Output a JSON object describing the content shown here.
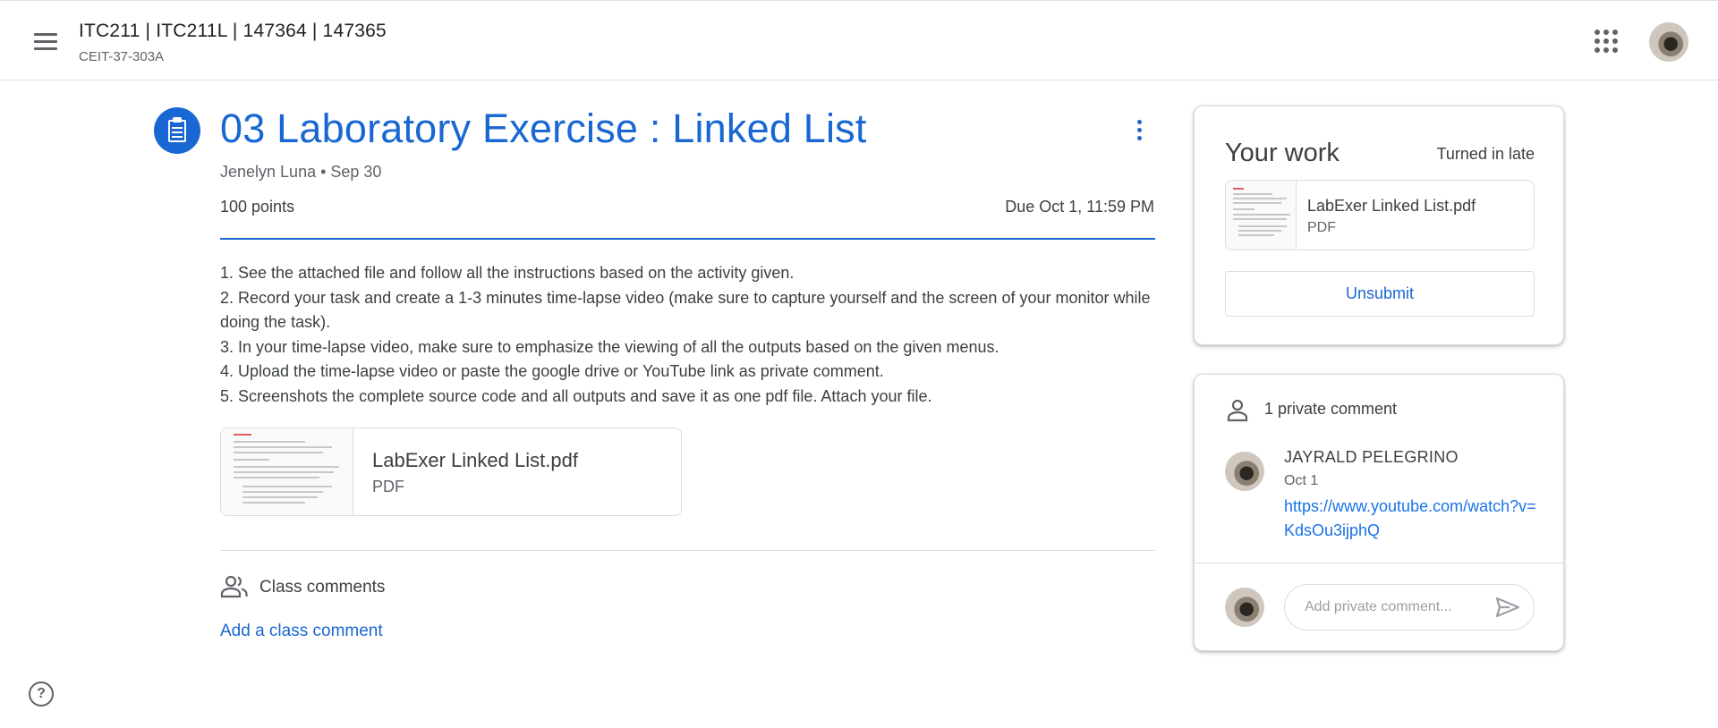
{
  "header": {
    "class_title": "ITC211 | ITC211L | 147364 | 147365",
    "class_section": "CEIT-37-303A",
    "icons": {
      "menu": "hamburger-menu-icon",
      "apps": "google-apps-grid-icon",
      "account": "account-avatar"
    }
  },
  "assignment": {
    "icon": "assignment-clipboard-icon",
    "title": "03 Laboratory Exercise : Linked List",
    "meta": "Jenelyn Luna • Sep 30",
    "points": "100 points",
    "due": "Due Oct 1, 11:59 PM",
    "instructions": [
      "1. See the attached file and follow all the instructions based on the activity given.",
      "2. Record your task and create a 1-3 minutes time-lapse video (make sure to capture yourself and the screen of your monitor while doing the task).",
      "3. In your time-lapse video, make sure to emphasize the viewing of all the outputs based on the given menus.",
      "4. Upload the time-lapse video or paste the google drive or YouTube link as private comment.",
      "5. Screenshots the complete source code and all outputs and save it as one pdf file. Attach your file."
    ],
    "attachment": {
      "name": "LabExer Linked List.pdf",
      "type": "PDF"
    }
  },
  "class_comments": {
    "label": "Class comments",
    "add_link": "Add a class comment"
  },
  "your_work": {
    "title": "Your work",
    "status": "Turned in late",
    "file": {
      "name": "LabExer Linked List.pdf",
      "type": "PDF"
    },
    "unsubmit_label": "Unsubmit"
  },
  "private_comments": {
    "count_label": "1 private comment",
    "comments": [
      {
        "author": "JAYRALD PELEGRINO",
        "date": "Oct 1",
        "text": "https://www.youtube.com/watch?v=KdsOu3ijphQ"
      }
    ],
    "input_placeholder": "Add private comment..."
  },
  "colors": {
    "accent": "#1967d2",
    "link": "#1a73e8",
    "text": "#3c4043",
    "muted": "#5f6368",
    "border": "#dadce0"
  }
}
